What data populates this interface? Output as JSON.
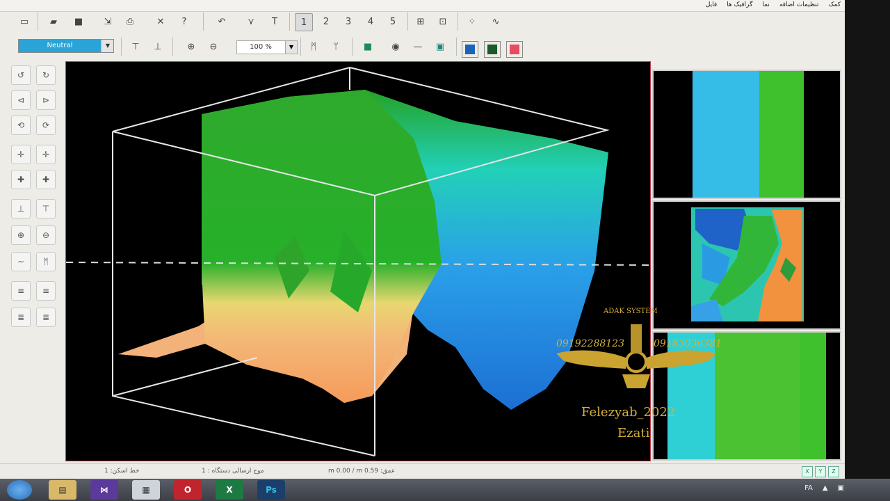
{
  "menu": [
    "فایل",
    "گرافیک ها",
    "نما",
    "تنظیمات اضافه",
    "کمک"
  ],
  "toolbar": {
    "page_buttons": [
      "1",
      "2",
      "3",
      "4",
      "5"
    ],
    "colormap_value": "Neutral",
    "zoom_value": "100 %",
    "color_swatches": [
      "#1a63b8",
      "#1c5a2c",
      "#e94b5e"
    ]
  },
  "watermark": {
    "brand": "ADAK SYSTEM",
    "phone_left": "09192288123",
    "phone_right": "09183036381",
    "handle": "Felezyab_2022",
    "name": "Ezati"
  },
  "status": {
    "line": "خط اسکن: 1",
    "device": "موج ارسالی دستگاه : 1",
    "depth": "عمق: m 0.00 / m 0.59"
  },
  "window_buttons": [
    "X",
    "Y",
    "Z"
  ],
  "taskbar": {
    "apps": [
      "explorer",
      "visual-studio",
      "calendar",
      "opera",
      "excel",
      "photoshop"
    ],
    "language": "FA"
  }
}
